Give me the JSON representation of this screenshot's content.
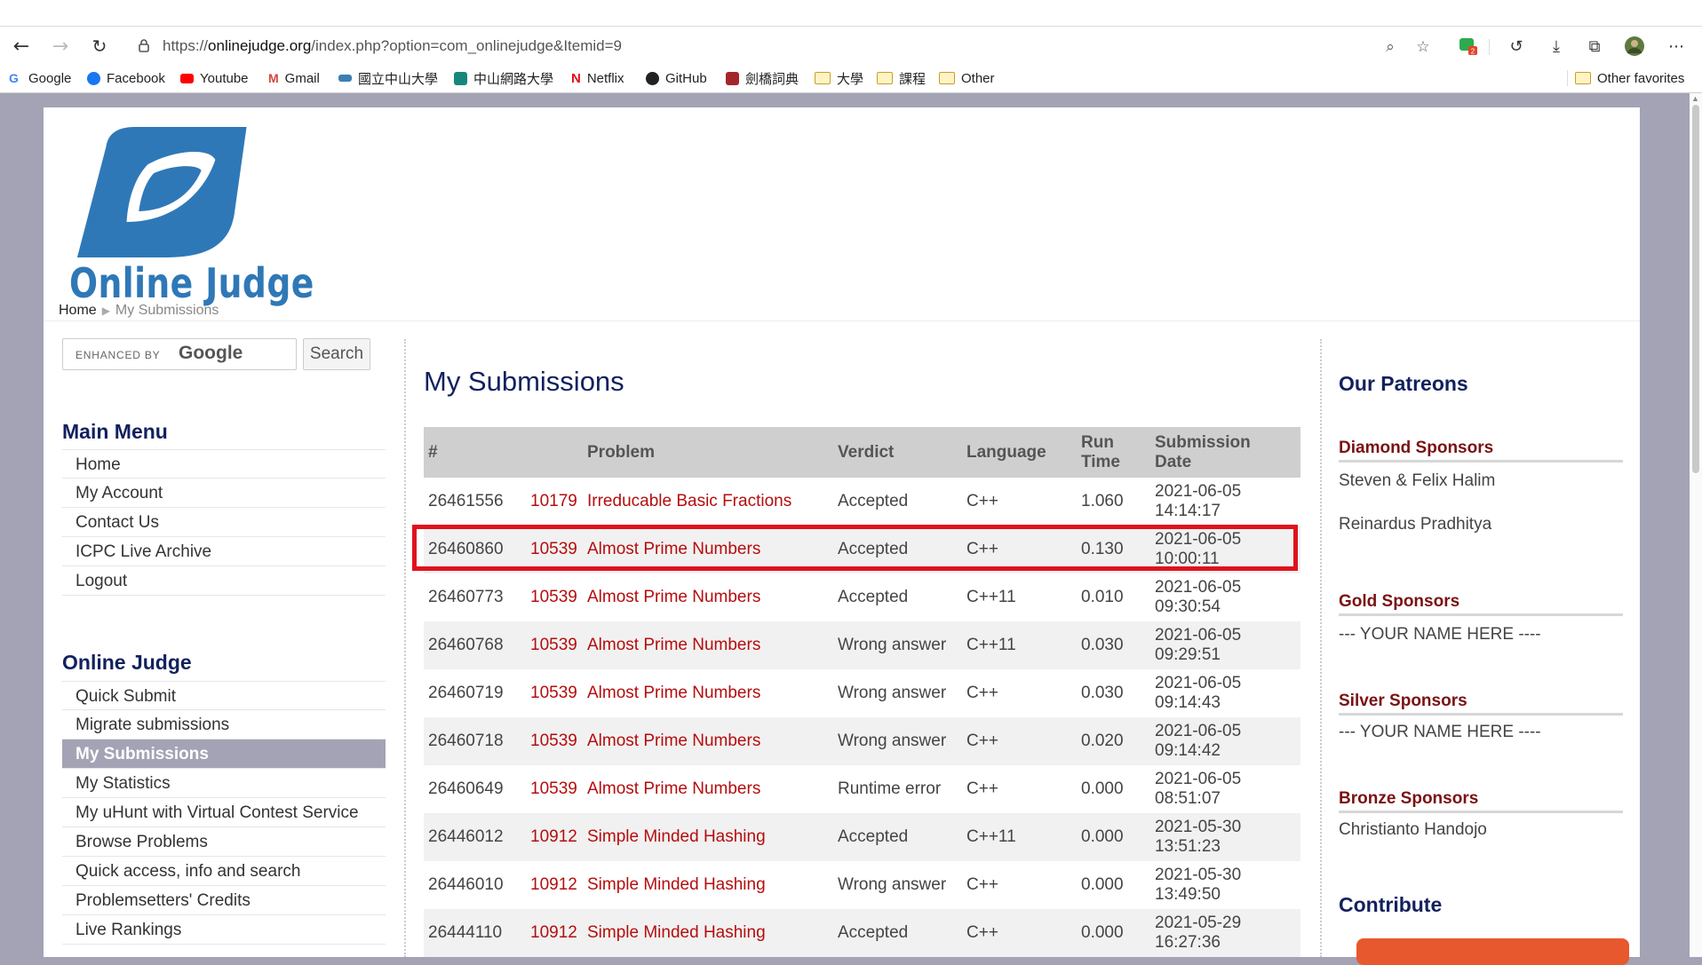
{
  "browser": {
    "url_prefix": "https://",
    "url_host": "onlinejudge.org",
    "url_path": "/index.php?option=com_onlinejudge&Itemid=9",
    "bookmarks": [
      {
        "label": "Google"
      },
      {
        "label": "Facebook"
      },
      {
        "label": "Youtube"
      },
      {
        "label": "Gmail"
      },
      {
        "label": "國立中山大學"
      },
      {
        "label": "中山網路大學"
      },
      {
        "label": "Netflix"
      },
      {
        "label": "GitHub"
      },
      {
        "label": "劍橋詞典"
      },
      {
        "label": "大學"
      },
      {
        "label": "課程"
      },
      {
        "label": "Other"
      }
    ],
    "other_favorites": "Other favorites",
    "extension_badge": "2"
  },
  "header": {
    "logo_text": "Online Judge",
    "breadcrumb_home": "Home",
    "breadcrumb_current": "My Submissions"
  },
  "search": {
    "enhanced_label": "ENHANCED BY",
    "google_label": "Google",
    "button_label": "Search"
  },
  "main_menu": {
    "title": "Main Menu",
    "items": [
      {
        "label": "Home"
      },
      {
        "label": "My Account"
      },
      {
        "label": "Contact Us"
      },
      {
        "label": "ICPC Live Archive"
      },
      {
        "label": "Logout"
      }
    ]
  },
  "oj_menu": {
    "title": "Online Judge",
    "items": [
      {
        "label": "Quick Submit"
      },
      {
        "label": "Migrate submissions"
      },
      {
        "label": "My Submissions"
      },
      {
        "label": "My Statistics"
      },
      {
        "label": "My uHunt with Virtual Contest Service"
      },
      {
        "label": "Browse Problems"
      },
      {
        "label": "Quick access, info and search"
      },
      {
        "label": "Problemsetters' Credits"
      },
      {
        "label": "Live Rankings"
      }
    ]
  },
  "main": {
    "title": "My Submissions",
    "columns": {
      "id": "#",
      "problem": "Problem",
      "verdict": "Verdict",
      "language": "Language",
      "runtime_l1": "Run",
      "runtime_l2": "Time",
      "date_l1": "Submission",
      "date_l2": "Date"
    },
    "rows": [
      {
        "id": "26461556",
        "pnum": "10179",
        "pname": "Irreducable Basic Fractions",
        "verdict": "Accepted",
        "lang": "C++",
        "time": "1.060",
        "date": "2021-06-05",
        "clock": "14:14:17"
      },
      {
        "id": "26460860",
        "pnum": "10539",
        "pname": "Almost Prime Numbers",
        "verdict": "Accepted",
        "lang": "C++",
        "time": "0.130",
        "date": "2021-06-05",
        "clock": "10:00:11"
      },
      {
        "id": "26460773",
        "pnum": "10539",
        "pname": "Almost Prime Numbers",
        "verdict": "Accepted",
        "lang": "C++11",
        "time": "0.010",
        "date": "2021-06-05",
        "clock": "09:30:54"
      },
      {
        "id": "26460768",
        "pnum": "10539",
        "pname": "Almost Prime Numbers",
        "verdict": "Wrong answer",
        "lang": "C++11",
        "time": "0.030",
        "date": "2021-06-05",
        "clock": "09:29:51"
      },
      {
        "id": "26460719",
        "pnum": "10539",
        "pname": "Almost Prime Numbers",
        "verdict": "Wrong answer",
        "lang": "C++",
        "time": "0.030",
        "date": "2021-06-05",
        "clock": "09:14:43"
      },
      {
        "id": "26460718",
        "pnum": "10539",
        "pname": "Almost Prime Numbers",
        "verdict": "Wrong answer",
        "lang": "C++",
        "time": "0.020",
        "date": "2021-06-05",
        "clock": "09:14:42"
      },
      {
        "id": "26460649",
        "pnum": "10539",
        "pname": "Almost Prime Numbers",
        "verdict": "Runtime error",
        "lang": "C++",
        "time": "0.000",
        "date": "2021-06-05",
        "clock": "08:51:07"
      },
      {
        "id": "26446012",
        "pnum": "10912",
        "pname": "Simple Minded Hashing",
        "verdict": "Accepted",
        "lang": "C++11",
        "time": "0.000",
        "date": "2021-05-30",
        "clock": "13:51:23"
      },
      {
        "id": "26446010",
        "pnum": "10912",
        "pname": "Simple Minded Hashing",
        "verdict": "Wrong answer",
        "lang": "C++",
        "time": "0.000",
        "date": "2021-05-30",
        "clock": "13:49:50"
      },
      {
        "id": "26444110",
        "pnum": "10912",
        "pname": "Simple Minded Hashing",
        "verdict": "Accepted",
        "lang": "C++",
        "time": "0.000",
        "date": "2021-05-29",
        "clock": "16:27:36"
      }
    ]
  },
  "right": {
    "patreons_title": "Our Patreons",
    "diamond_title": "Diamond Sponsors",
    "diamond_1": "Steven & Felix Halim",
    "diamond_2": "Reinardus Pradhitya",
    "gold_title": "Gold Sponsors",
    "gold_1": "--- YOUR NAME HERE ----",
    "silver_title": "Silver Sponsors",
    "silver_1": "--- YOUR NAME HERE ----",
    "bronze_title": "Bronze Sponsors",
    "bronze_1": "Christianto Handojo",
    "contribute_title": "Contribute"
  },
  "colors": {
    "accent_navy": "#12215e",
    "problem_red": "#b50d0d",
    "highlight_red": "#e0121c",
    "active_menu": "#a3a3b5",
    "logo_blue": "#2f78b7"
  }
}
